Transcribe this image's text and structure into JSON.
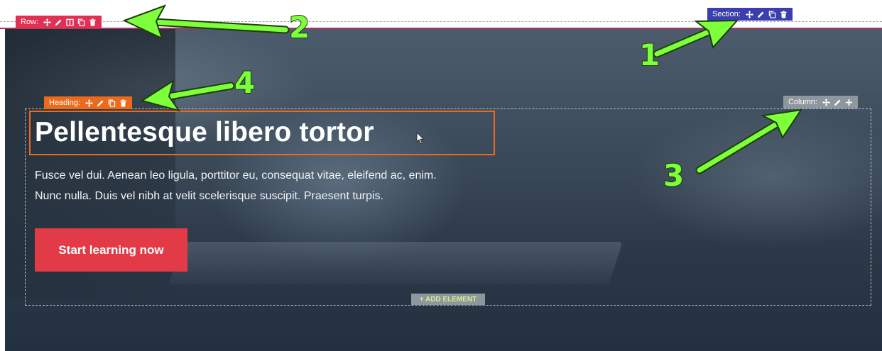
{
  "toolbars": {
    "row": {
      "label": "Row:"
    },
    "section": {
      "label": "Section:"
    },
    "heading": {
      "label": "Heading:"
    },
    "column": {
      "label": "Column:"
    }
  },
  "hero": {
    "heading": "Pellentesque libero tortor",
    "paragraph_lines": [
      "Fusce vel dui. Aenean leo ligula, porttitor eu, consequat vitae, eleifend ac, enim.",
      "Nunc nulla. Duis vel nibh at velit scelerisque suscipit. Praesent turpis."
    ],
    "cta_label": "Start learning now",
    "add_element_label": "+ ADD ELEMENT"
  },
  "annotations": [
    "1",
    "2",
    "3",
    "4"
  ],
  "colors": {
    "row": "#e23055",
    "section": "#3a3eae",
    "heading": "#ec6a1c",
    "column": "#8e969e",
    "cta": "#e33a47",
    "arrow": "#7dff3a"
  }
}
